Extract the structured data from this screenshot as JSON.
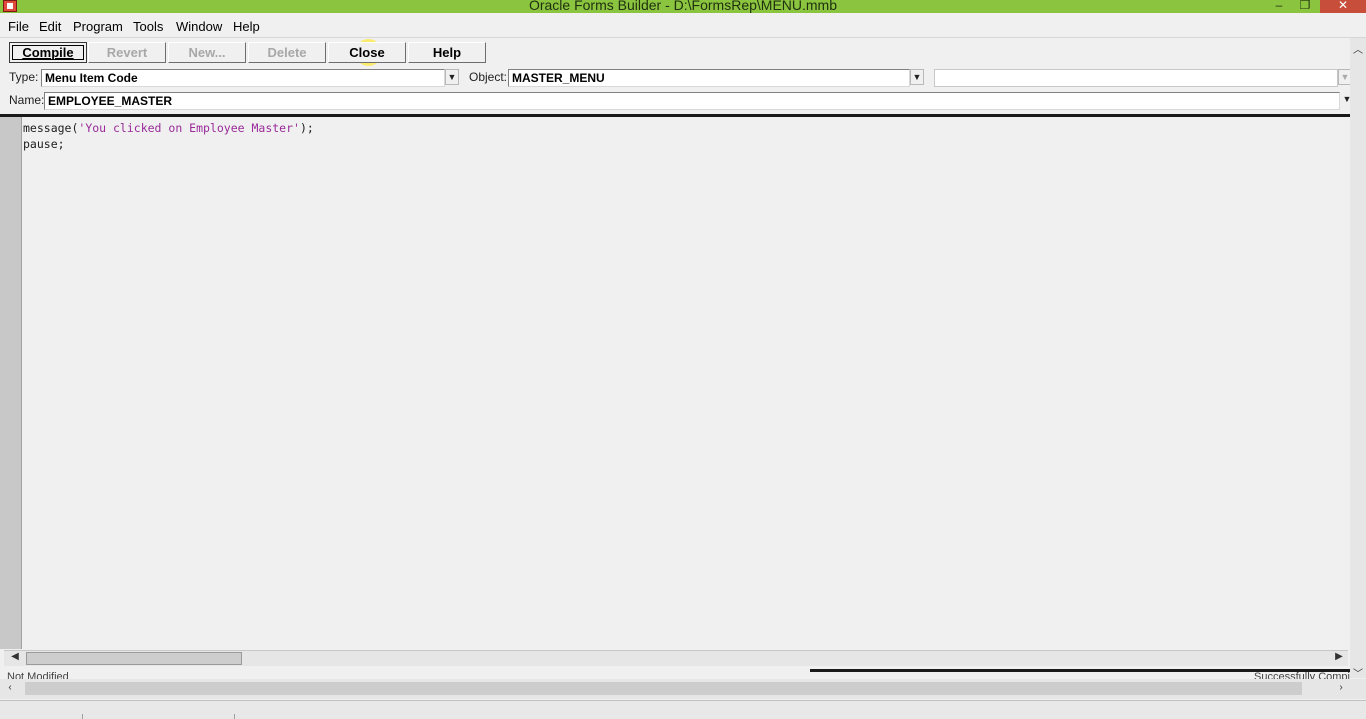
{
  "window": {
    "title": "Oracle Forms Builder - D:\\FormsRep\\MENU.mmb",
    "min_glyph": "–",
    "max_glyph": "❐",
    "close_glyph": "✕",
    "titlebar_color": "#8bc53f",
    "close_color": "#c74e3a"
  },
  "menu": [
    "File",
    "Edit",
    "Program",
    "Tools",
    "Window",
    "Help"
  ],
  "toolbar": {
    "compile": "Compile",
    "revert": "Revert",
    "new": "New...",
    "delete": "Delete",
    "close": "Close",
    "help": "Help"
  },
  "selectors": {
    "type_label": "Type:",
    "type_value": "Menu Item Code",
    "object_label": "Object:",
    "object_value": "MASTER_MENU",
    "third_value": "",
    "name_label": "Name:",
    "name_value": "EMPLOYEE_MASTER"
  },
  "code": {
    "line1_pre": "message(",
    "line1_str": "'You clicked on Employee Master'",
    "line1_post": ");",
    "line2": "pause;"
  },
  "status": {
    "left": "Not Modified",
    "right": "Successfully Compiled"
  }
}
